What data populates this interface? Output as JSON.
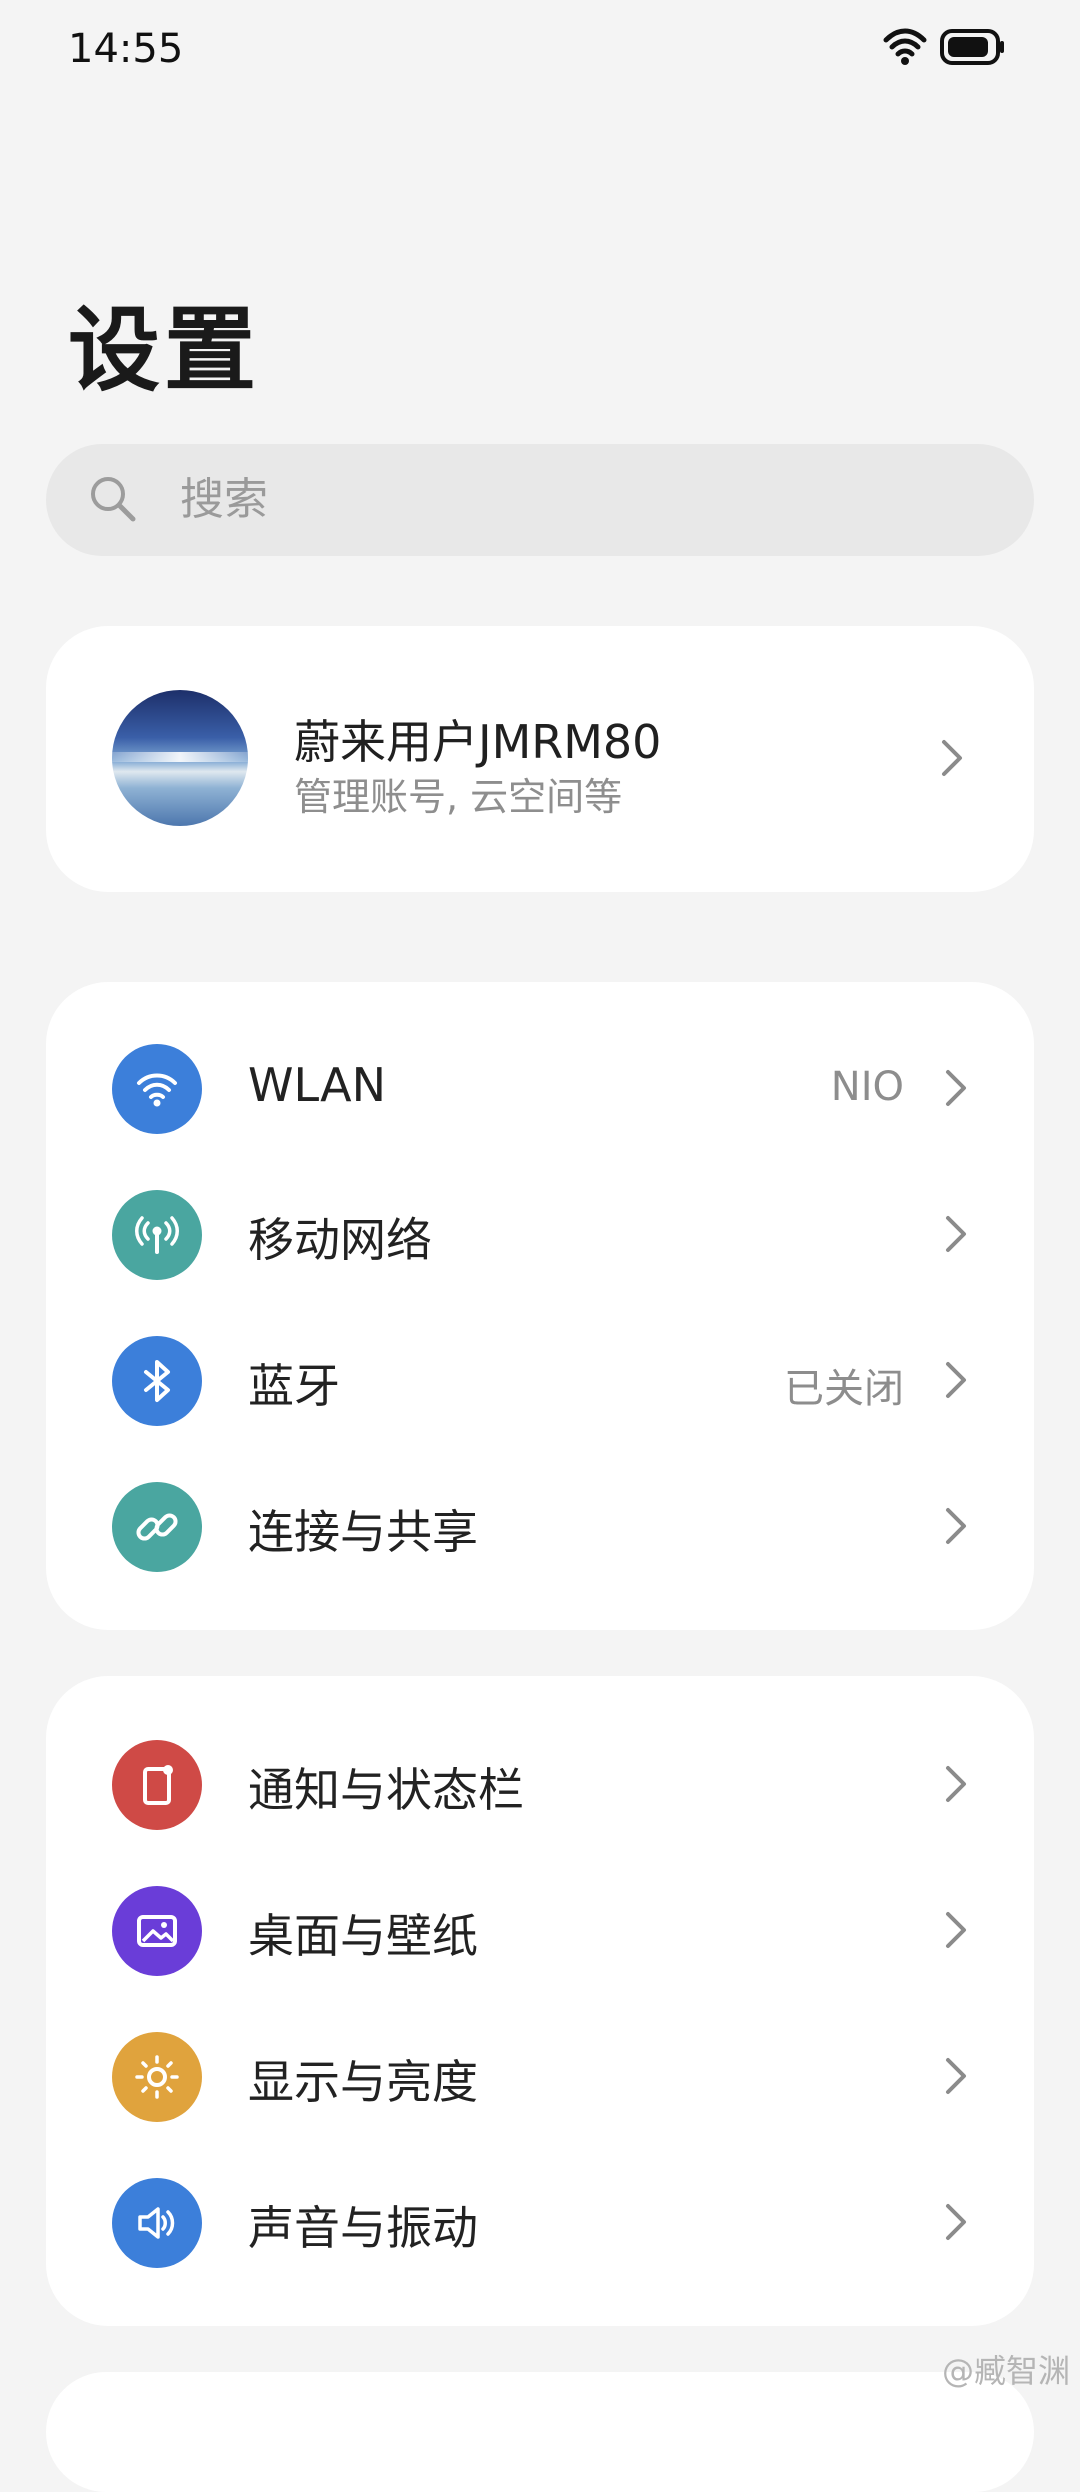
{
  "status_bar": {
    "time": "14:55"
  },
  "page": {
    "title": "设置"
  },
  "search": {
    "placeholder": "搜索"
  },
  "account": {
    "name": "蔚来用户JMRM80",
    "subtitle": "管理账号, 云空间等"
  },
  "network_items": [
    {
      "label": "WLAN",
      "value": "NIO",
      "icon": "wifi-icon",
      "color": "#3c7fda"
    },
    {
      "label": "移动网络",
      "value": "",
      "icon": "cellular-icon",
      "color": "#4aa6a0"
    },
    {
      "label": "蓝牙",
      "value": "已关闭",
      "icon": "bluetooth-icon",
      "color": "#3c7fda"
    },
    {
      "label": "连接与共享",
      "value": "",
      "icon": "link-icon",
      "color": "#4aa6a0"
    }
  ],
  "system_items": [
    {
      "label": "通知与状态栏",
      "icon": "notification-icon",
      "color": "#cf4a46"
    },
    {
      "label": "桌面与壁纸",
      "icon": "wallpaper-icon",
      "color": "#6a3dd8"
    },
    {
      "label": "显示与亮度",
      "icon": "brightness-icon",
      "color": "#e0a33d"
    },
    {
      "label": "声音与振动",
      "icon": "sound-icon",
      "color": "#3c7fda"
    }
  ],
  "watermark": "@臧智渊"
}
